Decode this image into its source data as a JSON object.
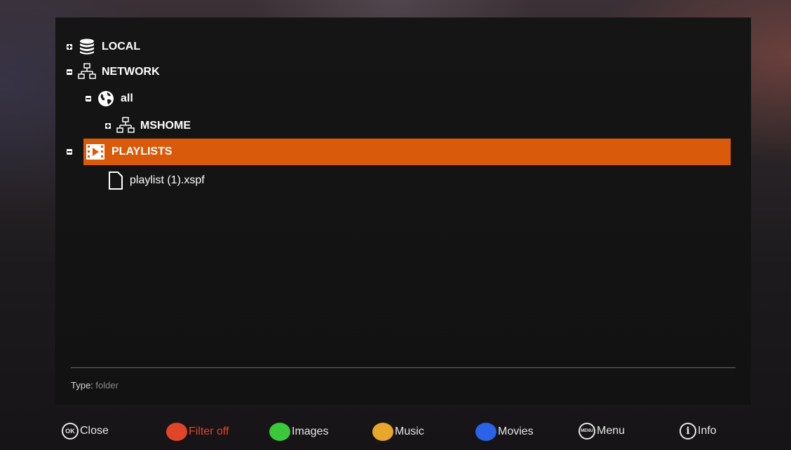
{
  "tree": {
    "items": [
      {
        "label": "LOCAL",
        "icon": "database-icon",
        "toggle": "plus"
      },
      {
        "label": "NETWORK",
        "icon": "network-icon",
        "toggle": "minus"
      },
      {
        "label": "all",
        "icon": "globe-icon",
        "toggle": "minus"
      },
      {
        "label": "MSHOME",
        "icon": "network-icon",
        "toggle": "plus"
      },
      {
        "label": "PLAYLISTS",
        "icon": "film-icon",
        "toggle": "minus",
        "selected": true
      },
      {
        "label": "playlist (1).xspf",
        "icon": "file-icon"
      }
    ]
  },
  "info": {
    "type_key": "Type:",
    "type_value": "folder"
  },
  "footer": {
    "ok_icon_text": "OK",
    "close_label": "Close",
    "filter_label": "Filter off",
    "images_label": "Images",
    "music_label": "Music",
    "movies_label": "Movies",
    "menu_icon_text": "MENU",
    "menu_label": "Menu",
    "info_icon_text": "i",
    "info_label": "Info"
  },
  "colors": {
    "selection": "#d95a0a",
    "red": "#e0452a",
    "green": "#39c93a",
    "yellow": "#e8a62a",
    "blue": "#2a62e8"
  }
}
